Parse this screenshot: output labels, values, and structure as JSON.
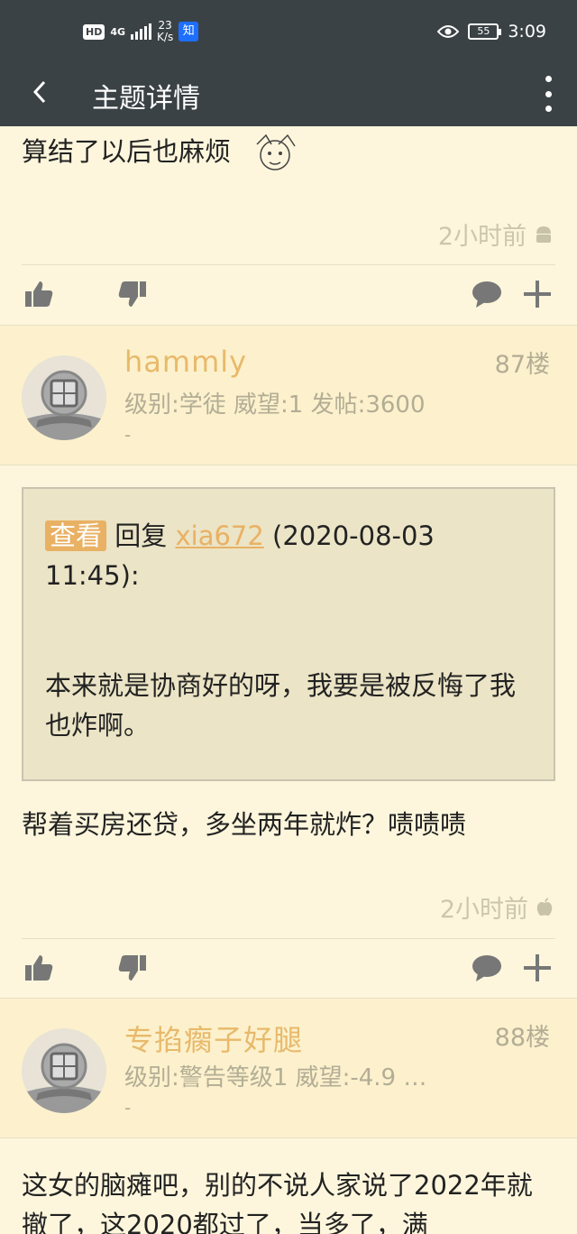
{
  "status_bar": {
    "hd": "HD",
    "network": "4G",
    "speed_value": "23",
    "speed_unit": "K/s",
    "app_badge": "知",
    "battery": "55",
    "time": "3:09"
  },
  "app_bar": {
    "back_icon": "chevron-left-icon",
    "title": "主题详情",
    "more_icon": "more-vertical-icon"
  },
  "post_prev": {
    "text": "算结了以后也麻烦",
    "time": "2小时前",
    "os_icon": "android-icon"
  },
  "post_87": {
    "username": "hammly",
    "meta": "级别:学徒   威望:1   发帖:3600",
    "meta2": "-",
    "floor": "87楼",
    "quote": {
      "tag": "查看",
      "reply_label": "回复",
      "reply_user": "xia672",
      "reply_meta": "(2020-08-03 11:45):",
      "body": "本来就是协商好的呀，我要是被反悔了我也炸啊。"
    },
    "text": "帮着买房还贷，多坐两年就炸？啧啧啧",
    "time": "2小时前",
    "os_icon": "apple-icon"
  },
  "post_88": {
    "username": "专掐瘸子好腿",
    "meta": "级别:警告等级1   威望:-4.9 …",
    "meta2": "-",
    "floor": "88楼",
    "text": "这女的脑瘫吧，别的不说人家说了2022年就撤了，这2020都过了，当多了，满"
  },
  "colors": {
    "bar": "#3b4246",
    "background": "#fdf6dc",
    "header_background": "#fcf1cc",
    "accent": "#e9b164"
  }
}
